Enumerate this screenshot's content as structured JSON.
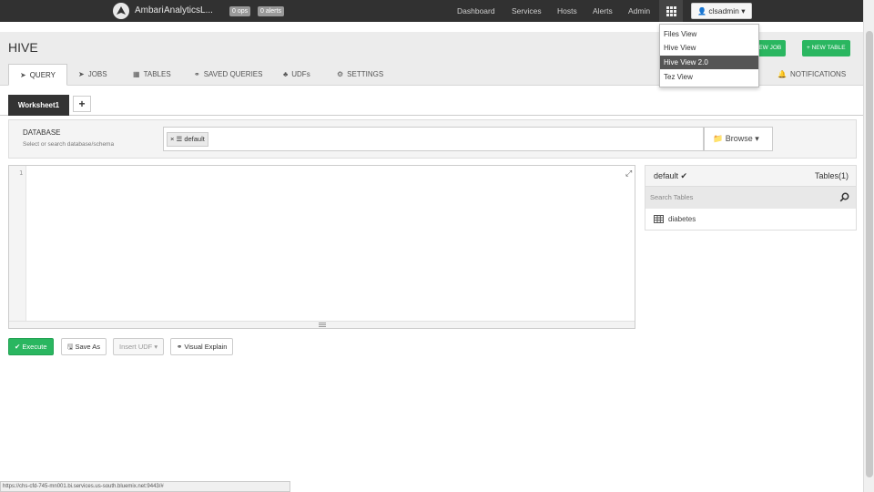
{
  "topbar": {
    "brand": "Ambari",
    "cluster": "AnalyticsL...",
    "badges": [
      "0 ops",
      "0 alerts"
    ],
    "nav": [
      "Dashboard",
      "Services",
      "Hosts",
      "Alerts",
      "Admin"
    ],
    "user": "clsadmin ▾"
  },
  "header": {
    "title": "HIVE",
    "tabs": [
      "QUERY",
      "JOBS",
      "TABLES",
      "SAVED QUERIES",
      "UDFs",
      "SETTINGS",
      "NOTIFICATIONS"
    ],
    "active_tab": "QUERY",
    "new_job": "+ NEW JOB",
    "new_table": "+ NEW TABLE"
  },
  "views_menu": {
    "items": [
      "Files View",
      "Hive View",
      "Hive View 2.0",
      "Tez View"
    ],
    "selected": "Hive View 2.0"
  },
  "worksheet": {
    "tab": "Worksheet1",
    "add": "+"
  },
  "database": {
    "label": "DATABASE",
    "hint": "Select or search database/schema",
    "selected": "default",
    "chip_remove": "×",
    "browse": "Browse ▾"
  },
  "editor": {
    "line_number": "1"
  },
  "tables_panel": {
    "db": "default ✔",
    "count": "Tables(1)",
    "search_placeholder": "Search Tables",
    "tables": [
      "diabetes"
    ]
  },
  "actions": {
    "execute": "Execute",
    "save_as": "Save As",
    "insert_udf": "Insert UDF ▾",
    "visual_explain": "Visual Explain"
  },
  "status_url": "https://chs-cfd-745-mn001.bi.services.us-south.bluemix.net:9443/#",
  "colors": {
    "topbar": "#313131",
    "accent_green": "#2ab660",
    "menu_selected": "#555555"
  }
}
